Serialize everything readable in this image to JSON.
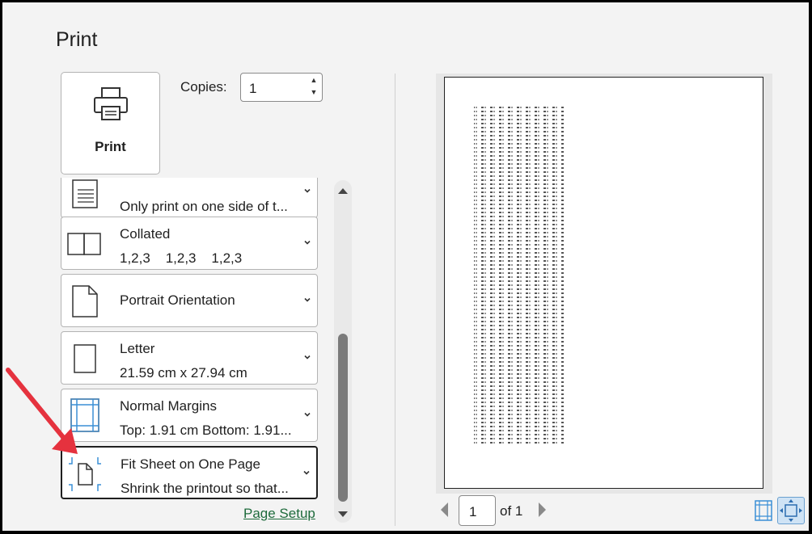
{
  "title": "Print",
  "print_button": {
    "label": "Print",
    "icon": "printer-icon"
  },
  "copies": {
    "label": "Copies:",
    "value": "1"
  },
  "settings": [
    {
      "title": "",
      "subtitle": "Only print on one side of t...",
      "icon": "one-sided-document-icon"
    },
    {
      "title": "Collated",
      "subtitle": "1,2,3    1,2,3    1,2,3",
      "icon": "collated-icon"
    },
    {
      "title": "Portrait Orientation",
      "subtitle": "",
      "icon": "portrait-page-icon"
    },
    {
      "title": "Letter",
      "subtitle": "21.59 cm x 27.94 cm",
      "icon": "paper-size-icon"
    },
    {
      "title": "Normal Margins",
      "subtitle": "Top: 1.91 cm Bottom: 1.91...",
      "icon": "margins-icon"
    },
    {
      "title": "Fit Sheet on One Page",
      "subtitle": "Shrink the printout so that...",
      "icon": "fit-to-page-icon",
      "selected": true
    }
  ],
  "page_setup_link": "Page Setup",
  "preview": {
    "current_page": "1",
    "of_label": "of 1"
  },
  "colors": {
    "accent_link": "#1e6b3c",
    "arrow": "#e5323e",
    "icon_blue": "#3a8fd6",
    "zoom_bg": "#cfe3f5"
  }
}
